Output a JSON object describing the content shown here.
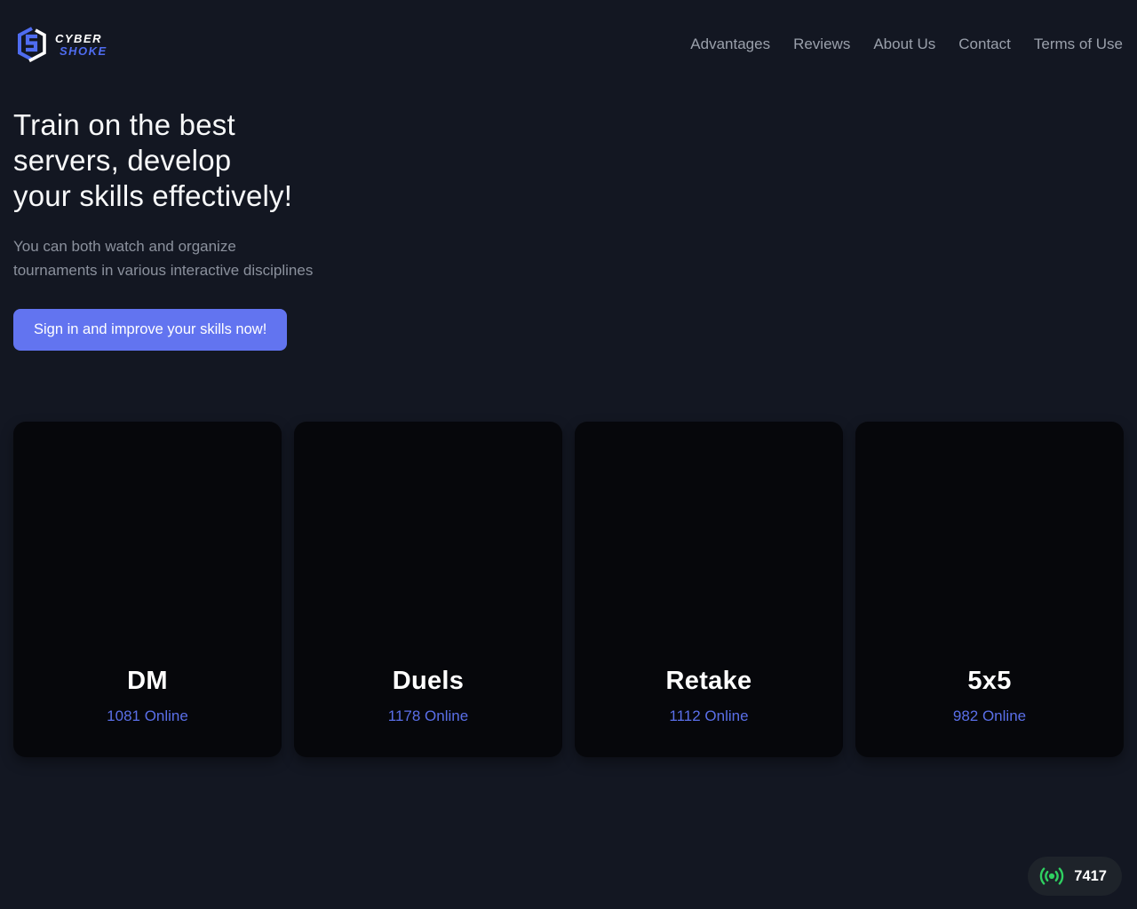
{
  "brand": {
    "name_top": "CYBER",
    "name_bottom": "SHOKE"
  },
  "nav": {
    "items": [
      {
        "label": "Advantages"
      },
      {
        "label": "Reviews"
      },
      {
        "label": "About Us"
      },
      {
        "label": "Contact"
      },
      {
        "label": "Terms of Use"
      }
    ]
  },
  "hero": {
    "title_line1": "Train on the best",
    "title_line2": "servers, develop",
    "title_line3": "your skills effectively!",
    "subtitle_line1": "You can both watch and organize",
    "subtitle_line2": "tournaments in various interactive disciplines",
    "cta_label": "Sign in and improve your skills now!"
  },
  "cards": [
    {
      "title": "DM",
      "online": "1081 Online"
    },
    {
      "title": "Duels",
      "online": "1178 Online"
    },
    {
      "title": "Retake",
      "online": "1112 Online"
    },
    {
      "title": "5x5",
      "online": "982 Online"
    }
  ],
  "online_badge": {
    "count": "7417",
    "icon": "broadcast-icon"
  },
  "colors": {
    "page_background": "#131722",
    "card_background": "#06070b",
    "accent_blue": "#6274f0",
    "online_text_blue": "#5a6fe8",
    "live_green": "#2fd061",
    "nav_gray": "#9aa0ab"
  }
}
